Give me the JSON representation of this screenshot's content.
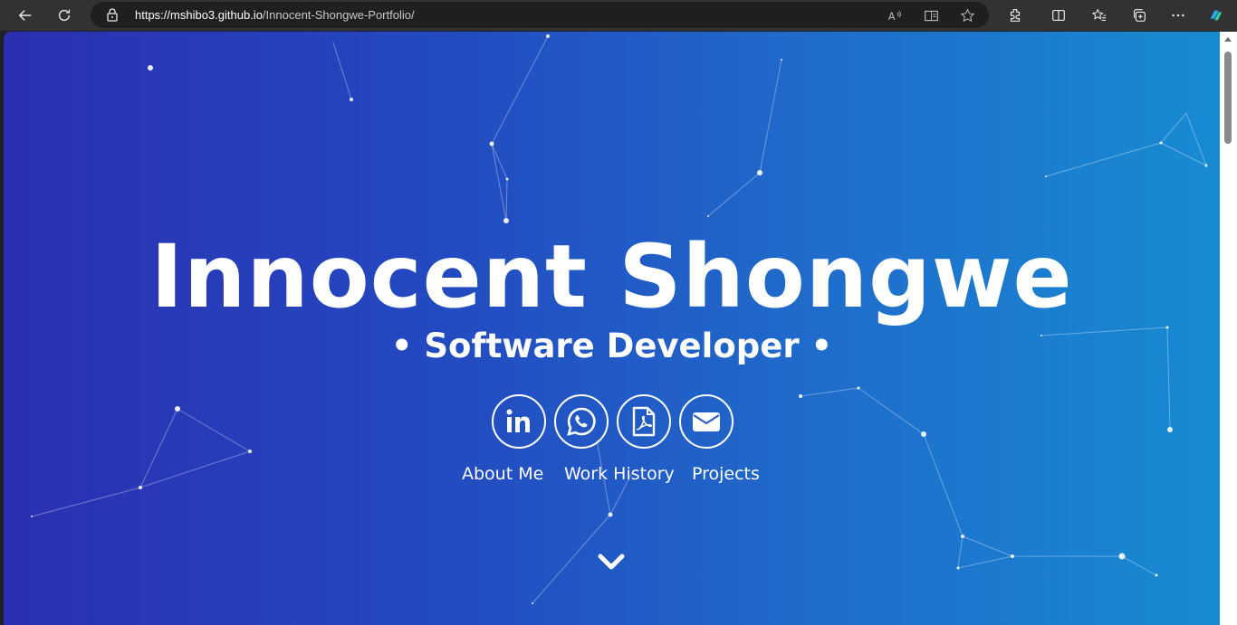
{
  "browser": {
    "url_host": "https://mshibo3.github.io",
    "url_path": "/Innocent-Shongwe-Portfolio/",
    "icons": [
      "back-icon",
      "refresh-icon",
      "lock-icon",
      "read-aloud-icon",
      "immersive-reader-icon",
      "favorite-star-icon",
      "extensions-icon",
      "split-screen-icon",
      "favorites-icon",
      "collections-icon",
      "more-icon",
      "copilot-icon"
    ]
  },
  "hero": {
    "title": "Innocent Shongwe",
    "subtitle": "• Software Developer •"
  },
  "social": [
    {
      "name": "linkedin",
      "icon": "linkedin-icon"
    },
    {
      "name": "whatsapp",
      "icon": "whatsapp-icon"
    },
    {
      "name": "resume-pdf",
      "icon": "pdf-icon"
    },
    {
      "name": "email",
      "icon": "envelope-icon"
    }
  ],
  "nav": {
    "about": "About Me",
    "work": "Work History",
    "projects": "Projects"
  },
  "colors": {
    "gradient_start": "#2b2fb1",
    "gradient_end": "#178bd2",
    "text": "#ffffff"
  }
}
